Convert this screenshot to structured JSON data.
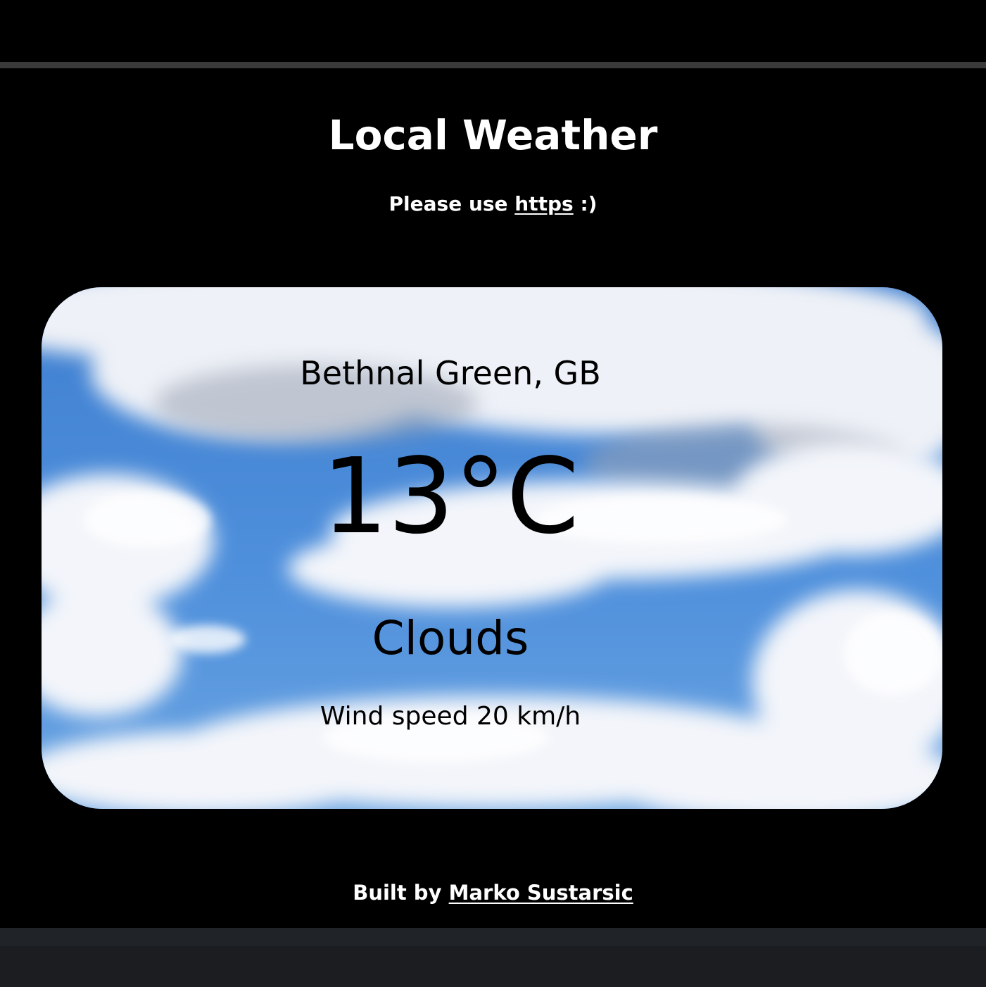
{
  "header": {
    "title": "Local Weather",
    "notice_prefix": "Please use",
    "notice_link": "https",
    "notice_suffix": ":)"
  },
  "weather": {
    "location": "Bethnal Green, GB",
    "temperature": "13°C",
    "condition": "Clouds",
    "wind": "Wind speed 20 km/h"
  },
  "footer": {
    "prefix": "Built by",
    "author_link": "Marko Sustarsic"
  },
  "colors": {
    "page_background": "#000000",
    "sky_blue": "#4f8fd8",
    "cloud_white": "#f2f4fa",
    "card_text": "#000000",
    "bottom_bar": "#1b1d21"
  }
}
